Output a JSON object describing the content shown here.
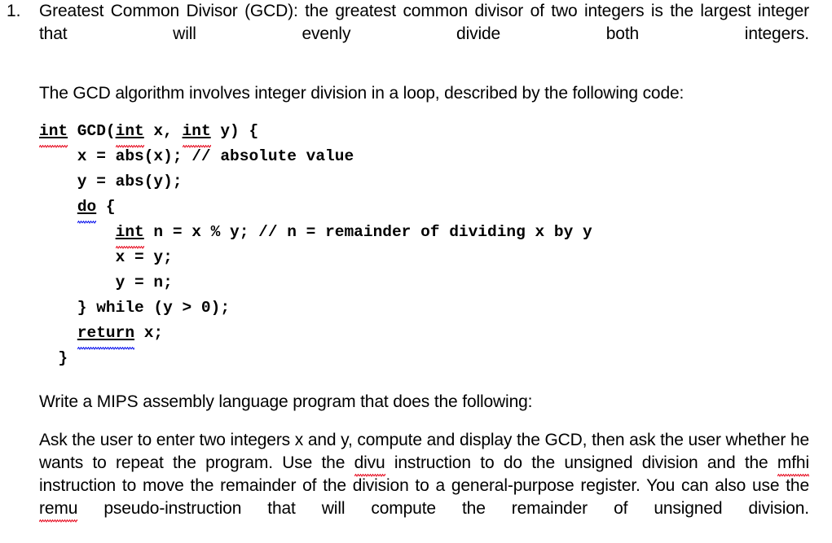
{
  "document": {
    "list_marker": "1.",
    "paragraphs": {
      "intro": "Greatest Common Divisor (GCD): the greatest common divisor of two integers is the largest integer that will evenly divide both integers.",
      "algo": "The GCD algorithm involves integer division in a loop, described by the following code:",
      "write": "Write a MIPS assembly language program that does the following:",
      "ask_part1": "Ask the user to enter two integers x and y, compute and display the GCD, then ask the user whether he wants to repeat the program. Use the ",
      "ask_divu": "divu",
      "ask_part2": " instruction to do the unsigned division and the ",
      "ask_mfhi": "mfhi",
      "ask_part3": " instruction to move the remainder of the division to a general-purpose register. You can also use the ",
      "ask_remu": "remu",
      "ask_part4": " pseudo-instruction that will compute the remainder of unsigned division."
    },
    "code": {
      "language": "c",
      "lines": [
        {
          "id": "signature",
          "segments": [
            {
              "text": "int",
              "keyword": true,
              "squiggle": "red"
            },
            {
              "text": " GCD(",
              "keyword": false,
              "squiggle": "none"
            },
            {
              "text": "int",
              "keyword": true,
              "squiggle": "red"
            },
            {
              "text": " x, ",
              "keyword": false,
              "squiggle": "none"
            },
            {
              "text": "int",
              "keyword": true,
              "squiggle": "red"
            },
            {
              "text": " y) {",
              "keyword": false,
              "squiggle": "none"
            }
          ]
        },
        {
          "id": "abs-x",
          "segments": [
            {
              "text": "    x = abs(x); // absolute value",
              "keyword": false,
              "squiggle": "none"
            }
          ]
        },
        {
          "id": "abs-y",
          "segments": [
            {
              "text": "    y = abs(y);",
              "keyword": false,
              "squiggle": "none"
            }
          ]
        },
        {
          "id": "do-open",
          "segments": [
            {
              "text": "    ",
              "keyword": false,
              "squiggle": "none"
            },
            {
              "text": "do",
              "keyword": true,
              "squiggle": "blue"
            },
            {
              "text": " {",
              "keyword": false,
              "squiggle": "none"
            }
          ]
        },
        {
          "id": "remainder",
          "segments": [
            {
              "text": "        ",
              "keyword": false,
              "squiggle": "none"
            },
            {
              "text": "int",
              "keyword": true,
              "squiggle": "red"
            },
            {
              "text": " n = x % y; // n = remainder of dividing x by y",
              "keyword": false,
              "squiggle": "none"
            }
          ]
        },
        {
          "id": "assign-x",
          "segments": [
            {
              "text": "        x = y;",
              "keyword": false,
              "squiggle": "none"
            }
          ]
        },
        {
          "id": "assign-y",
          "segments": [
            {
              "text": "        y = n;",
              "keyword": false,
              "squiggle": "none"
            }
          ]
        },
        {
          "id": "while",
          "segments": [
            {
              "text": "    } while (y > 0);",
              "keyword": false,
              "squiggle": "none"
            }
          ]
        },
        {
          "id": "return",
          "segments": [
            {
              "text": "    ",
              "keyword": false,
              "squiggle": "none"
            },
            {
              "text": "return",
              "keyword": true,
              "squiggle": "blue"
            },
            {
              "text": " x;",
              "keyword": false,
              "squiggle": "none"
            }
          ]
        },
        {
          "id": "close-brace",
          "segments": [
            {
              "text": "  }",
              "keyword": false,
              "squiggle": "none"
            }
          ]
        }
      ]
    },
    "colors": {
      "text": "#000000",
      "background": "#ffffff",
      "spellcheck_red": "#e8192c",
      "grammar_blue": "#1a22ee"
    }
  }
}
